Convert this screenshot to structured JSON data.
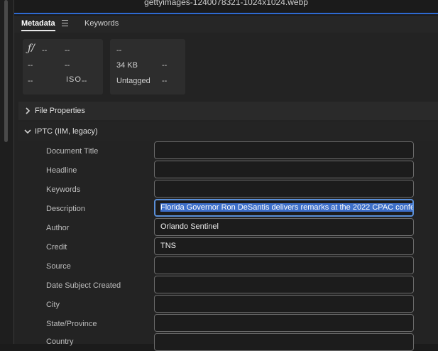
{
  "window": {
    "title": "gettyimages-1240078321-1024x1024.webp"
  },
  "tabs": [
    {
      "label": "Metadata",
      "active": true
    },
    {
      "label": "Keywords",
      "active": false
    }
  ],
  "exif_tiles": {
    "tile1": {
      "aperture_symbol": "ƒ/",
      "aperture": "--",
      "shutter": "--",
      "exposure": "--",
      "focal": "--",
      "metering": "--",
      "iso_label": "ISO",
      "iso": "--"
    },
    "tile2": {
      "dimensions": "--",
      "size": "34 KB",
      "color_space": "--",
      "color_profile": "Untagged",
      "bit_depth": "--"
    }
  },
  "sections": {
    "file_properties": {
      "label": "File Properties",
      "expanded": false
    },
    "iptc": {
      "label": "IPTC (IIM, legacy)",
      "expanded": true
    }
  },
  "iptc_fields": [
    {
      "label": "Document Title",
      "value": ""
    },
    {
      "label": "Headline",
      "value": ""
    },
    {
      "label": "Keywords",
      "value": ""
    },
    {
      "label": "Description",
      "value": "Florida Governor Ron DeSantis delivers remarks at the 2022 CPAC confe"
    },
    {
      "label": "Author",
      "value": "Orlando Sentinel"
    },
    {
      "label": "Credit",
      "value": "TNS"
    },
    {
      "label": "Source",
      "value": ""
    },
    {
      "label": "Date Subject Created",
      "value": ""
    },
    {
      "label": "City",
      "value": ""
    },
    {
      "label": "State/Province",
      "value": ""
    },
    {
      "label": "Country",
      "value": ""
    }
  ],
  "colors": {
    "accent": "#2e6ad1",
    "selection": "#3d6fc9",
    "panel": "#232323"
  },
  "icons": [
    "hamburger-menu-icon",
    "chevron-right-icon",
    "chevron-down-icon"
  ]
}
